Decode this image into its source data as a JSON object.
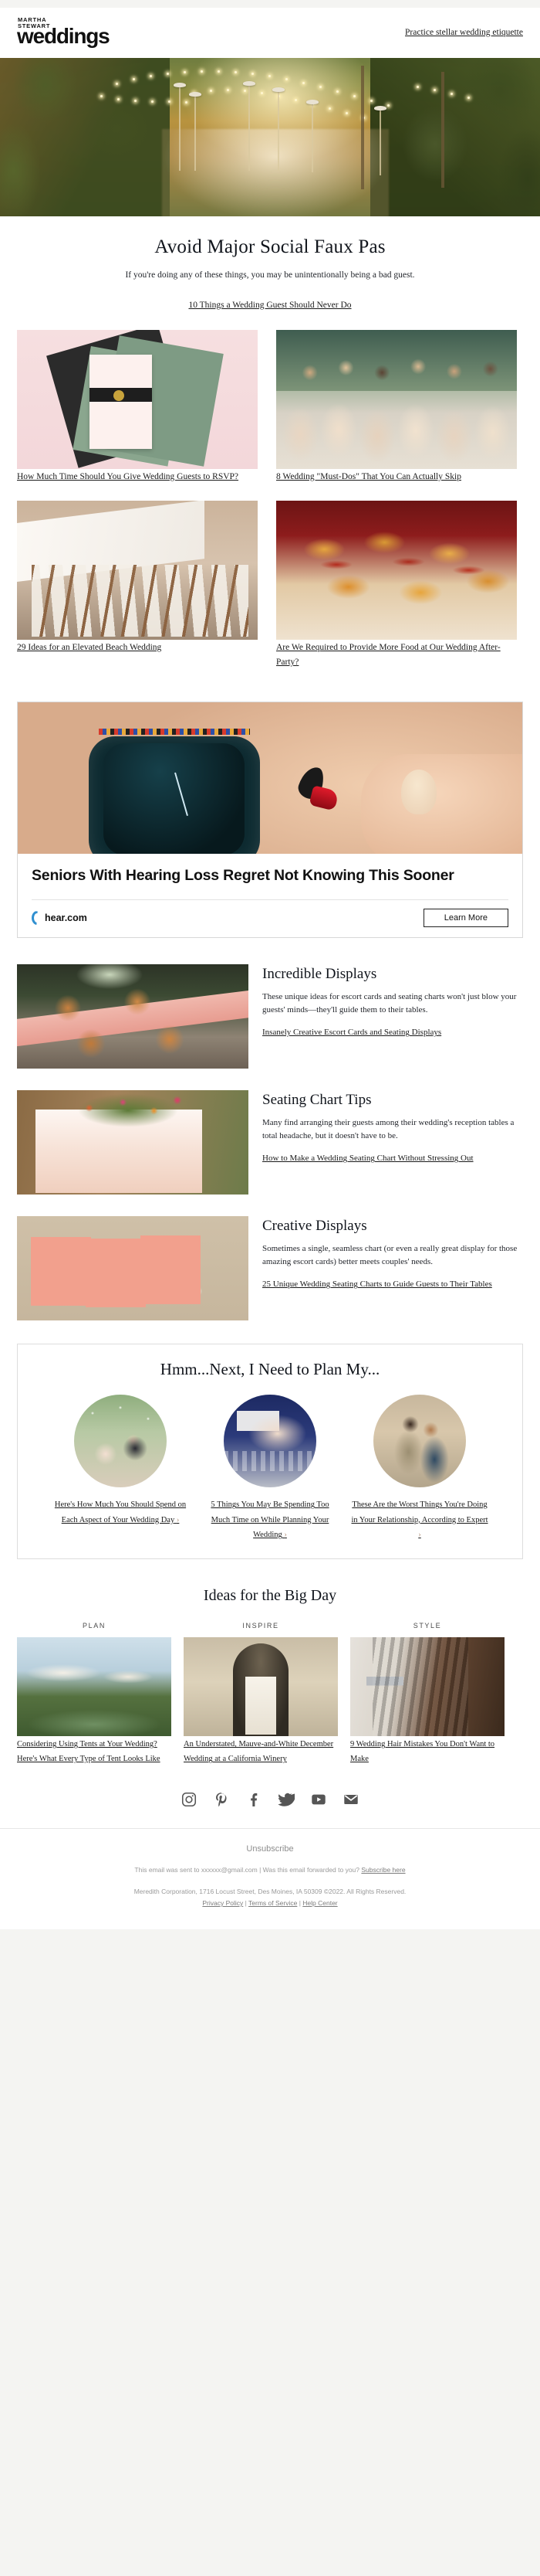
{
  "header": {
    "logo_kicker_line1": "MARTHA",
    "logo_kicker_line2": "STEWART",
    "logo_wordmark": "weddings",
    "etiquette_link": "Practice stellar wedding etiquette"
  },
  "hero": {
    "alt_name": "outdoor-wedding-reception-string-lights"
  },
  "lede": {
    "title": "Avoid Major Social Faux Pas",
    "dek": "If you're doing any of these things, you may be unintentionally being a bad guest.",
    "cta": "10 Things a Wedding Guest Should Never Do"
  },
  "grid": {
    "cards": [
      {
        "caption": "How Much Time Should You Give Wedding Guests to RSVP?",
        "image_name": "wedding-invitation-suite-photo"
      },
      {
        "caption": "8 Wedding \"Must-Dos\" That You Can Actually Skip",
        "image_name": "bridesmaids-champagne-toast-photo"
      },
      {
        "caption": "29 Ideas for an Elevated Beach Wedding",
        "image_name": "long-reception-table-photo"
      },
      {
        "caption": "Are We Required to Provide More Food at Our Wedding After-Party?",
        "image_name": "in-n-out-burgers-tray-photo"
      }
    ]
  },
  "ad": {
    "headline": "Seniors With Hearing Loss Regret Not Knowing This Sooner",
    "brand": "hear.com",
    "button": "Learn More",
    "image_name": "hearing-aid-and-smartwatch-photo"
  },
  "features": [
    {
      "title": "Incredible Displays",
      "body": "These unique ideas for escort cards and seating charts won't just blow your guests' minds—they'll guide them to their tables.",
      "link": "Insanely Creative Escort Cards and Seating Displays",
      "image_name": "copper-mugs-escort-cards-photo"
    },
    {
      "title": "Seating Chart Tips",
      "body": "Many find arranging their guests among their wedding's reception tables a total headache, but it doesn't have to be.",
      "link": "How to Make a Wedding Seating Chart Without Stressing Out",
      "image_name": "watercolor-seating-chart-photo"
    },
    {
      "title": "Creative Displays",
      "body": "Sometimes a single, seamless chart (or even a really great display for those amazing escort cards) better meets couples' needs.",
      "link": "25 Unique Wedding Seating Charts to Guide Guests to Their Tables",
      "image_name": "pink-escort-cards-with-flowers-photo"
    }
  ],
  "panel": {
    "title": "Hmm...Next, I Need to Plan My...",
    "arrow": "›",
    "items": [
      {
        "caption": "Here's How Much You Should Spend on Each Aspect of Your Wedding Day",
        "image_name": "newlyweds-confetti-photo"
      },
      {
        "caption": "5 Things You May Be Spending Too Much Time on While Planning Your Wedding",
        "image_name": "hands-phone-laptop-photo"
      },
      {
        "caption": "These Are the Worst Things You're Doing in Your Relationship, According to Expert",
        "image_name": "stressed-couple-photo"
      }
    ]
  },
  "bigday": {
    "title": "Ideas for the Big Day",
    "columns": [
      {
        "eyebrow": "PLAN",
        "caption": "Considering Using Tents at Your Wedding? Here's What Every Type of Tent Looks Like",
        "image_name": "wedding-tent-lakeside-photo"
      },
      {
        "eyebrow": "INSPIRE",
        "caption": "An Understated, Mauve-and-White December Wedding at a California Winery",
        "image_name": "couple-stone-archway-photo"
      },
      {
        "eyebrow": "STYLE",
        "caption": "9 Wedding Hair Mistakes You Don't Want to Make",
        "image_name": "hair-straightener-photo"
      }
    ]
  },
  "footer": {
    "social": [
      {
        "name": "instagram-icon",
        "label": "Instagram"
      },
      {
        "name": "pinterest-icon",
        "label": "Pinterest"
      },
      {
        "name": "facebook-icon",
        "label": "Facebook"
      },
      {
        "name": "twitter-icon",
        "label": "Twitter"
      },
      {
        "name": "youtube-icon",
        "label": "YouTube"
      },
      {
        "name": "email-icon",
        "label": "Email"
      }
    ],
    "unsubscribe": "Unsubscribe",
    "sent_prefix": "This email was sent to xxxxxx@gmail.com  |  Was this email forwarded to you?",
    "subscribe_link": "Subscribe here",
    "copyright": "Meredith Corporation, 1716 Locust Street, Des Moines, IA 50309 ©2022. All Rights Reserved.",
    "privacy": "Privacy Policy",
    "terms": "Terms of Service",
    "help": "Help Center",
    "sep": " | "
  }
}
